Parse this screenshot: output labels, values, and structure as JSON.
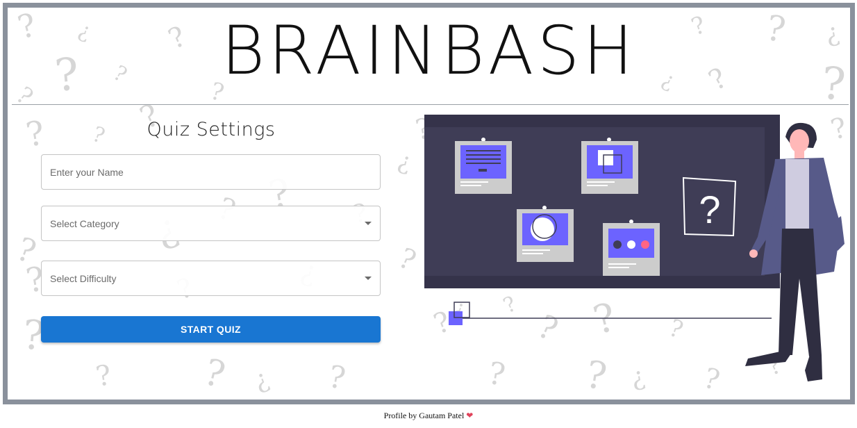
{
  "app": {
    "title": "BRAINBASH"
  },
  "settings": {
    "heading": "Quiz Settings",
    "name_placeholder": "Enter your Name",
    "name_value": "",
    "category_label": "Select Category",
    "difficulty_label": "Select Difficulty",
    "start_label": "START QUIZ"
  },
  "illustration": {
    "question_glyph": "?"
  },
  "footer": {
    "text": "Profile by Gautam Patel",
    "heart": "❤"
  },
  "colors": {
    "primary_button": "#1976d2",
    "board": "#3f3d56",
    "accent": "#6c63ff",
    "frame": "#8a919c"
  }
}
